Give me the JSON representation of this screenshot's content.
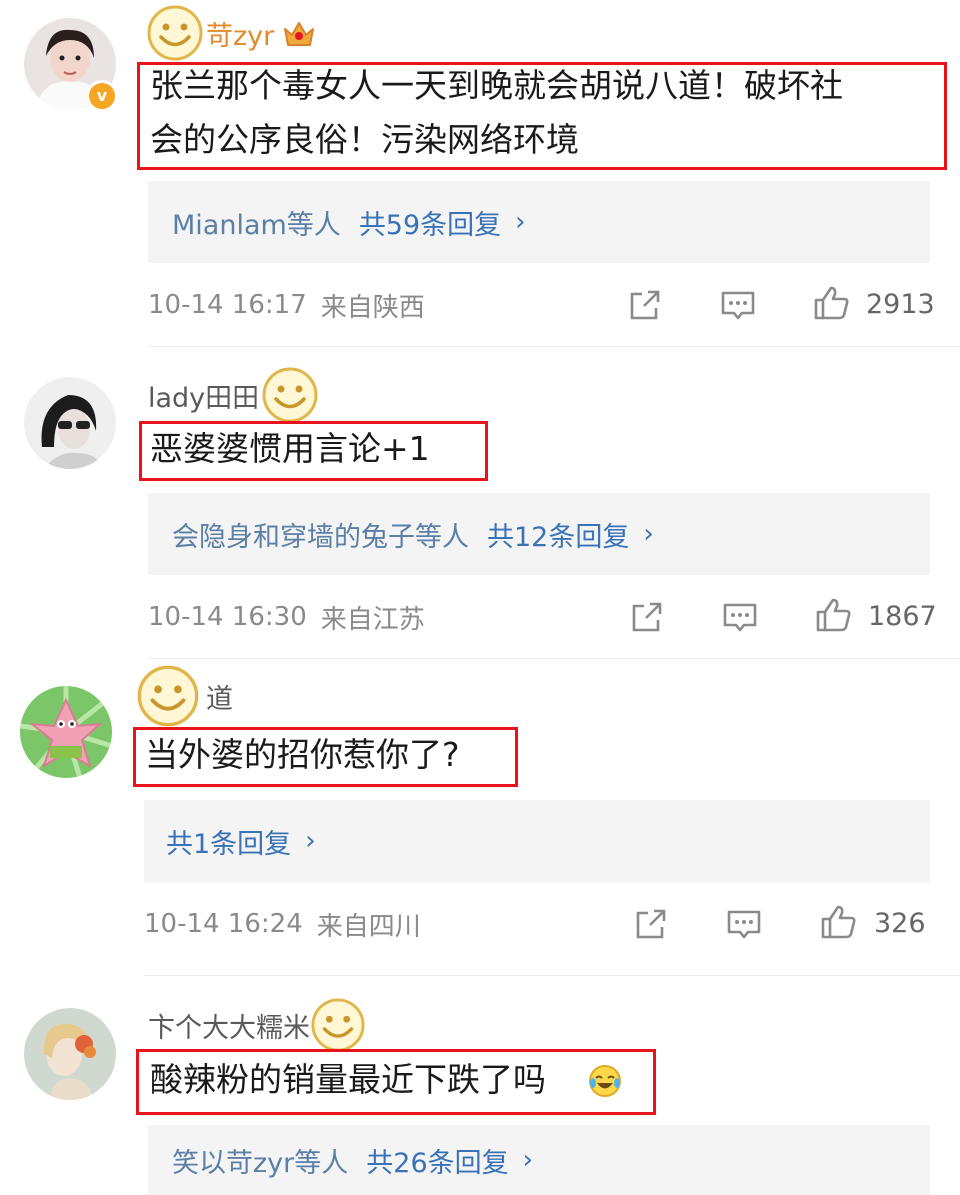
{
  "comments": [
    {
      "username": "苛zyr",
      "text_lines": [
        "张兰那个毒女人一天到晚就会胡说八道！破坏社",
        "会的公序良俗！污染网络环境"
      ],
      "replies_who": "Mianlam等人",
      "replies_count": "共59条回复",
      "time": "10-14 16:17",
      "location": "来自陕西",
      "likes": "2913"
    },
    {
      "username": "lady田田",
      "text_lines": [
        "恶婆婆惯用言论+1"
      ],
      "replies_who": "会隐身和穿墙的兔子等人",
      "replies_count": "共12条回复",
      "time": "10-14 16:30",
      "location": "来自江苏",
      "likes": "1867"
    },
    {
      "username": "道",
      "text_lines": [
        "当外婆的招你惹你了?"
      ],
      "replies_who": "",
      "replies_count": "共1条回复",
      "time": "10-14 16:24",
      "location": "来自四川",
      "likes": "326"
    },
    {
      "username": "卞个大大糯米",
      "text_lines": [
        "酸辣粉的销量最近下跌了吗"
      ],
      "replies_who": "笑以苛zyr等人",
      "replies_count": "共26条回复"
    }
  ],
  "icons": {
    "smiley": "smiley-emoji-icon",
    "crown": "vip-crown-icon",
    "verified": "verified-v-icon",
    "share": "share-icon",
    "reply": "comment-icon",
    "like": "thumbs-up-icon",
    "chevron": "chevron-right-icon",
    "laugh_cry": "laughing-crying-emoji-icon"
  },
  "colors": {
    "highlight_border": "#e8141c",
    "link_blue": "#3a72b8",
    "reply_bg": "#f4f4f4"
  }
}
